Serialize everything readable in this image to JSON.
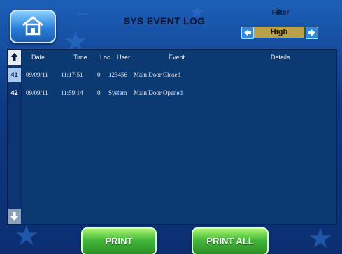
{
  "header": {
    "title": "SYS EVENT LOG",
    "home_icon": "home-icon"
  },
  "filter": {
    "label": "Filter",
    "value": "High"
  },
  "table": {
    "columns": [
      "Date",
      "Time",
      "Loc",
      "User",
      "Event",
      "Details"
    ],
    "row_ids": [
      "41",
      "42"
    ],
    "rows": [
      {
        "date": "09/09/11",
        "time": "11:17:51",
        "loc": "0",
        "user": "123456",
        "event": "Main Door Closed",
        "details": ""
      },
      {
        "date": "09/09/11",
        "time": "11:59:14",
        "loc": "0",
        "user": "System",
        "event": "Main Door Opened",
        "details": ""
      }
    ]
  },
  "buttons": {
    "print": "PRINT",
    "print_all": "PRINT ALL"
  },
  "colors": {
    "accent_green": "#43b83a",
    "panel_blue": "#0b3a73",
    "filter_gold": "#b9a14a"
  }
}
